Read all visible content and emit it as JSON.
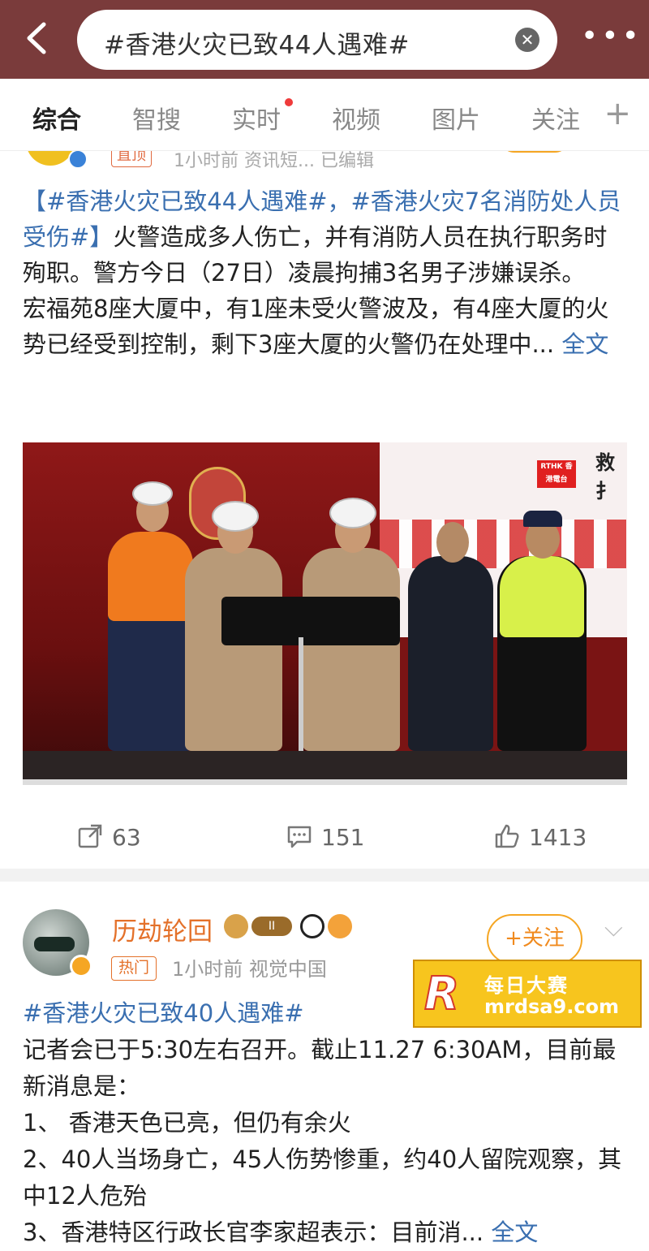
{
  "search": {
    "query": "#香港火灾已致44人遇难#"
  },
  "tabs": [
    {
      "label": "综合",
      "active": true
    },
    {
      "label": "智搜",
      "active": false
    },
    {
      "label": "实时",
      "active": false,
      "has_dot": true
    },
    {
      "label": "视频",
      "active": false
    },
    {
      "label": "图片",
      "active": false
    },
    {
      "label": "关注",
      "active": false
    }
  ],
  "post1": {
    "badge": "直顶",
    "meta": "1小时前  资讯短...  已编辑",
    "body_hashtags": "【#香港火灾已致44人遇难#，#香港火灾7名消防处人员受伤#】",
    "body_text1": "火警造成多人伤亡，并有消防人员在执行职务时殉职。警方今日（27日）凌晨拘捕3名男子涉嫌误杀。",
    "body_text2": "宏福苑8座大厦中，有1座未受火警波及，有4座大厦的火势已经受到控制，剩下3座大厦的火警仍在处理中...",
    "full_text_link": "全文",
    "image_overlay": {
      "rthk": "RTHK 香港電台",
      "caption": "救扌"
    },
    "stats": {
      "reposts": "63",
      "comments": "151",
      "likes": "1413"
    }
  },
  "post2": {
    "author": "历劫轮回",
    "rank_badge": "II",
    "hot_badge": "热门",
    "meta": "1小时前  视觉中国",
    "follow_label": "+关注",
    "hashtag": "#香港火灾已致40人遇难#",
    "lines": [
      "记者会已于5:30左右召开。截止11.27 6:30AM，目前最新消息是：",
      "1、 香港天色已亮，但仍有余火",
      "2、40人当场身亡，45人伤势惨重，约40人留院观察，其中12人危殆",
      "3、香港特区行政长官李家超表示：目前消..."
    ],
    "full_text_link": "全文"
  },
  "watermark": {
    "line1": "每日大赛",
    "line2": "mrdsa9.com"
  },
  "colors": {
    "topbar": "#7a3b3b",
    "link": "#3a6fb0",
    "accent_orange": "#f5a623"
  }
}
